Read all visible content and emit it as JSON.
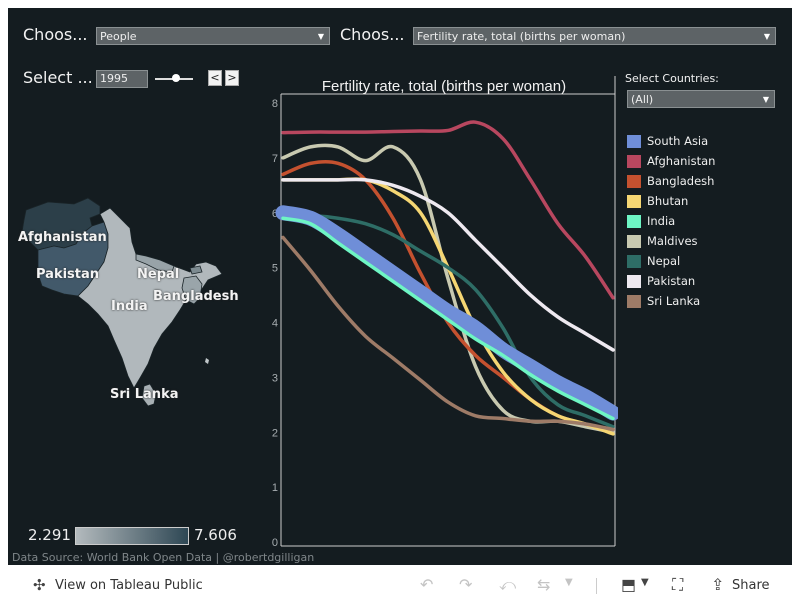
{
  "controls": {
    "choose1_label": "Choos...",
    "choose1_value": "People",
    "choose2_label": "Choos...",
    "choose2_value": "Fertility rate, total (births per woman)",
    "select_year_label": "Select ...",
    "year_value": "1995",
    "year_slider_fraction": 0.55,
    "prev_label": "<",
    "next_label": ">"
  },
  "legend": {
    "title": "Select Countries:",
    "filter_value": "(All)"
  },
  "map": {
    "labels": [
      "Afghanistan",
      "Pakistan",
      "Nepal",
      "India",
      "Bangladesh",
      "Sri Lanka"
    ],
    "gradient_min": "2.291",
    "gradient_max": "7.606",
    "gradient_colors": [
      "#b3babd",
      "#2e4754"
    ]
  },
  "source": "Data Source: World Bank Open Data | @robertdgilligan",
  "toolbar": {
    "view_label": "View on Tableau Public",
    "share_label": "Share"
  },
  "chart_data": {
    "type": "line",
    "title": "Fertility rate, total (births per woman)",
    "ylim": [
      0,
      8
    ],
    "yticks": [
      "0",
      "1",
      "2",
      "3",
      "4",
      "5",
      "6",
      "7",
      "8"
    ],
    "x": [
      0,
      1,
      2,
      3,
      4,
      5,
      6,
      7,
      8,
      9,
      10,
      11,
      12
    ],
    "series": [
      {
        "name": "Afghanistan",
        "color": "#b8475f",
        "values": [
          7.46,
          7.47,
          7.47,
          7.47,
          7.48,
          7.49,
          7.5,
          7.65,
          7.35,
          6.6,
          5.8,
          5.2,
          4.45
        ]
      },
      {
        "name": "Maldives",
        "color": "#c8c9b0",
        "values": [
          7.0,
          7.2,
          7.2,
          6.95,
          7.2,
          6.6,
          4.8,
          3.2,
          2.4,
          2.2,
          2.2,
          2.1,
          2.0
        ]
      },
      {
        "name": "Bangladesh",
        "color": "#c4512f",
        "values": [
          6.7,
          6.9,
          6.9,
          6.6,
          5.9,
          4.9,
          4.0,
          3.4,
          3.0,
          2.6,
          2.3,
          2.15,
          2.05
        ]
      },
      {
        "name": "Bhutan",
        "color": "#f5d673",
        "values": [
          6.6,
          6.6,
          6.6,
          6.6,
          6.4,
          6.0,
          5.0,
          3.9,
          3.1,
          2.6,
          2.3,
          2.15,
          1.97
        ]
      },
      {
        "name": "Pakistan",
        "color": "#eee9f0",
        "values": [
          6.6,
          6.6,
          6.6,
          6.6,
          6.5,
          6.3,
          6.0,
          5.5,
          5.0,
          4.5,
          4.1,
          3.8,
          3.5
        ]
      },
      {
        "name": "Nepal",
        "color": "#2e6d66",
        "values": [
          5.95,
          5.95,
          5.9,
          5.8,
          5.6,
          5.3,
          5.0,
          4.6,
          3.9,
          3.0,
          2.5,
          2.3,
          2.1
        ]
      },
      {
        "name": "South Asia",
        "color": "#6f8ed8",
        "values": [
          6.0,
          5.9,
          5.6,
          5.25,
          4.9,
          4.55,
          4.2,
          3.9,
          3.5,
          3.2,
          2.9,
          2.65,
          2.35
        ]
      },
      {
        "name": "India",
        "color": "#6ef5c4",
        "values": [
          5.9,
          5.8,
          5.45,
          5.1,
          4.75,
          4.4,
          4.05,
          3.7,
          3.4,
          3.05,
          2.75,
          2.5,
          2.25
        ]
      },
      {
        "name": "Sri Lanka",
        "color": "#9e7b67",
        "values": [
          5.55,
          4.95,
          4.3,
          3.75,
          3.35,
          2.95,
          2.55,
          2.3,
          2.25,
          2.2,
          2.2,
          2.15,
          2.05
        ]
      }
    ],
    "legend_order": [
      "South Asia",
      "Afghanistan",
      "Bangladesh",
      "Bhutan",
      "India",
      "Maldives",
      "Nepal",
      "Pakistan",
      "Sri Lanka"
    ],
    "legend_placement": "right",
    "grid": false
  }
}
